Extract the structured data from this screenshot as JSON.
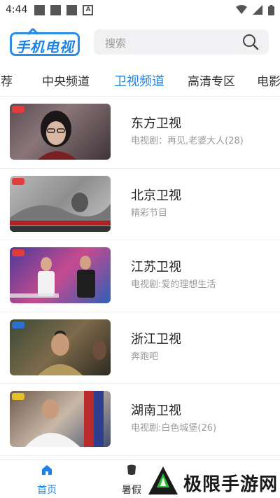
{
  "status_bar": {
    "time": "4:44"
  },
  "header": {
    "logo_text": "手机电视",
    "search_placeholder": "搜索"
  },
  "tabs": [
    {
      "label": "推荐"
    },
    {
      "label": "中央频道"
    },
    {
      "label": "卫视频道",
      "active": true
    },
    {
      "label": "高清专区"
    },
    {
      "label": "电影"
    }
  ],
  "channels": [
    {
      "name": "东方卫视",
      "program": "电视剧：再见,老婆大人(28)"
    },
    {
      "name": "北京卫视",
      "program": "精彩节目"
    },
    {
      "name": "江苏卫视",
      "program": "电视剧:爱的理想生活"
    },
    {
      "name": "浙江卫视",
      "program": "奔跑吧"
    },
    {
      "name": "湖南卫视",
      "program": "电视剧:白色城堡(26)"
    }
  ],
  "bottom_nav": {
    "home_label": "首页",
    "summer_label": "暑假"
  },
  "watermark": {
    "text": "极限手游网"
  },
  "colors": {
    "accent": "#1c83e6"
  }
}
